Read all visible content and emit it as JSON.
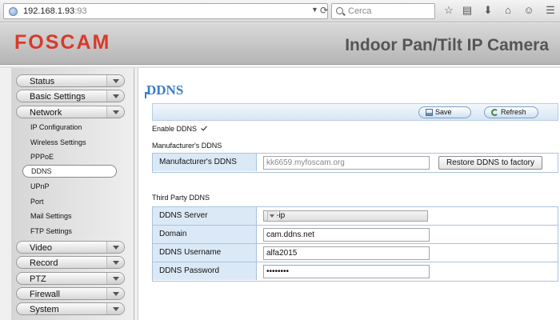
{
  "browser": {
    "url_host": "192.168.1.93",
    "url_port": ":93",
    "search_placeholder": "Cerca",
    "icons": [
      "star-icon",
      "bookmark-list-icon",
      "download-icon",
      "home-icon",
      "chat-icon"
    ]
  },
  "header": {
    "logo": "FOSCAM",
    "product_title": "Indoor Pan/Tilt IP Camera",
    "logo_color": "#d93a2b"
  },
  "sidebar": {
    "items": [
      {
        "label": "Status",
        "type": "main"
      },
      {
        "label": "Basic Settings",
        "type": "main"
      },
      {
        "label": "Network",
        "type": "main"
      },
      {
        "label": "IP Configuration",
        "type": "sub"
      },
      {
        "label": "Wireless Settings",
        "type": "sub"
      },
      {
        "label": "PPPoE",
        "type": "sub"
      },
      {
        "label": "DDNS",
        "type": "sub",
        "selected": true
      },
      {
        "label": "UPnP",
        "type": "sub"
      },
      {
        "label": "Port",
        "type": "sub"
      },
      {
        "label": "Mail Settings",
        "type": "sub"
      },
      {
        "label": "FTP Settings",
        "type": "sub"
      },
      {
        "label": "Video",
        "type": "main"
      },
      {
        "label": "Record",
        "type": "main"
      },
      {
        "label": "PTZ",
        "type": "main"
      },
      {
        "label": "Firewall",
        "type": "main"
      },
      {
        "label": "System",
        "type": "main"
      }
    ]
  },
  "content": {
    "heading": "DDNS",
    "accent_color": "#3a7dc4",
    "save_label": "Save",
    "refresh_label": "Refresh",
    "enable_label": "Enable DDNS",
    "enable_checked": true,
    "manufacturer_section": "Manufacturer's DDNS",
    "manufacturer_label": "Manufacturer's DDNS",
    "manufacturer_value": "kk6659.myfoscam.org",
    "restore_label": "Restore DDNS to factory",
    "third_party_section": "Third Party DDNS",
    "server_label": "DDNS Server",
    "server_value": "no-ip",
    "domain_label": "Domain",
    "domain_value": "cam.ddns.net",
    "username_label": "DDNS Username",
    "username_value": "alfa2015",
    "password_label": "DDNS Password",
    "password_value": "••••••••"
  }
}
